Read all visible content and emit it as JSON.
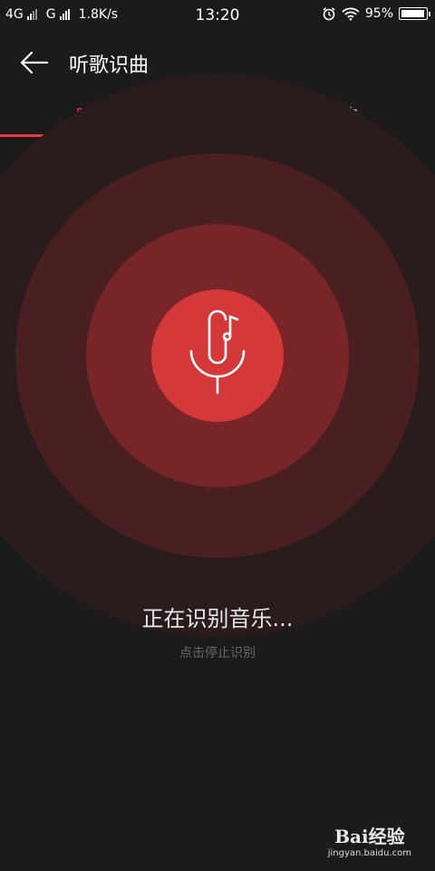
{
  "status_bar": {
    "network_1": "4G",
    "network_2": "G",
    "speed": "1.8K/s",
    "time": "13:20",
    "battery": "95%",
    "battery_level": 0.95
  },
  "header": {
    "title": "听歌识曲"
  },
  "tabs": [
    {
      "label": "听歌识曲",
      "active": true
    },
    {
      "label": "识别历史",
      "active": false
    }
  ],
  "recognition": {
    "status": "正在识别音乐...",
    "hint": "点击停止识别"
  },
  "watermark": {
    "brand": "Bai经验",
    "url": "jingyan.baidu.com"
  },
  "colors": {
    "accent": "#e23b3b",
    "background": "#1d1a1b"
  }
}
